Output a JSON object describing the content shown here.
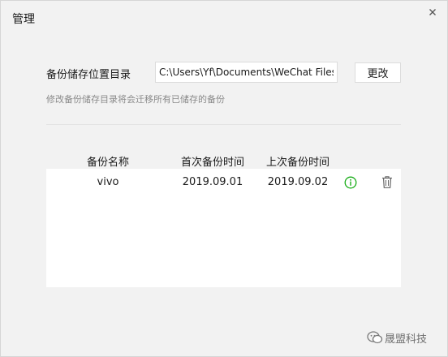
{
  "dialog": {
    "title": "管理",
    "close_icon": "close-icon"
  },
  "storage": {
    "label": "备份储存位置目录",
    "path_value": "C:\\Users\\Yf\\Documents\\WeChat Files\\",
    "change_button": "更改",
    "hint": "修改备份储存目录将会迁移所有已储存的备份"
  },
  "backups": {
    "columns": {
      "name": "备份名称",
      "first_backup": "首次备份时间",
      "last_backup": "上次备份时间"
    },
    "rows": [
      {
        "name": "vivo",
        "first_backup": "2019.09.01",
        "last_backup": "2019.09.02",
        "info_icon": "info-icon",
        "delete_icon": "trash-icon"
      }
    ]
  },
  "watermark": {
    "text": "晟盟科技",
    "logo_icon": "wechat-account-icon"
  },
  "colors": {
    "dialog_bg": "#f2f2f2",
    "panel_bg": "#ffffff",
    "info_green": "#1aad19",
    "hint_gray": "#8a8a8a"
  }
}
